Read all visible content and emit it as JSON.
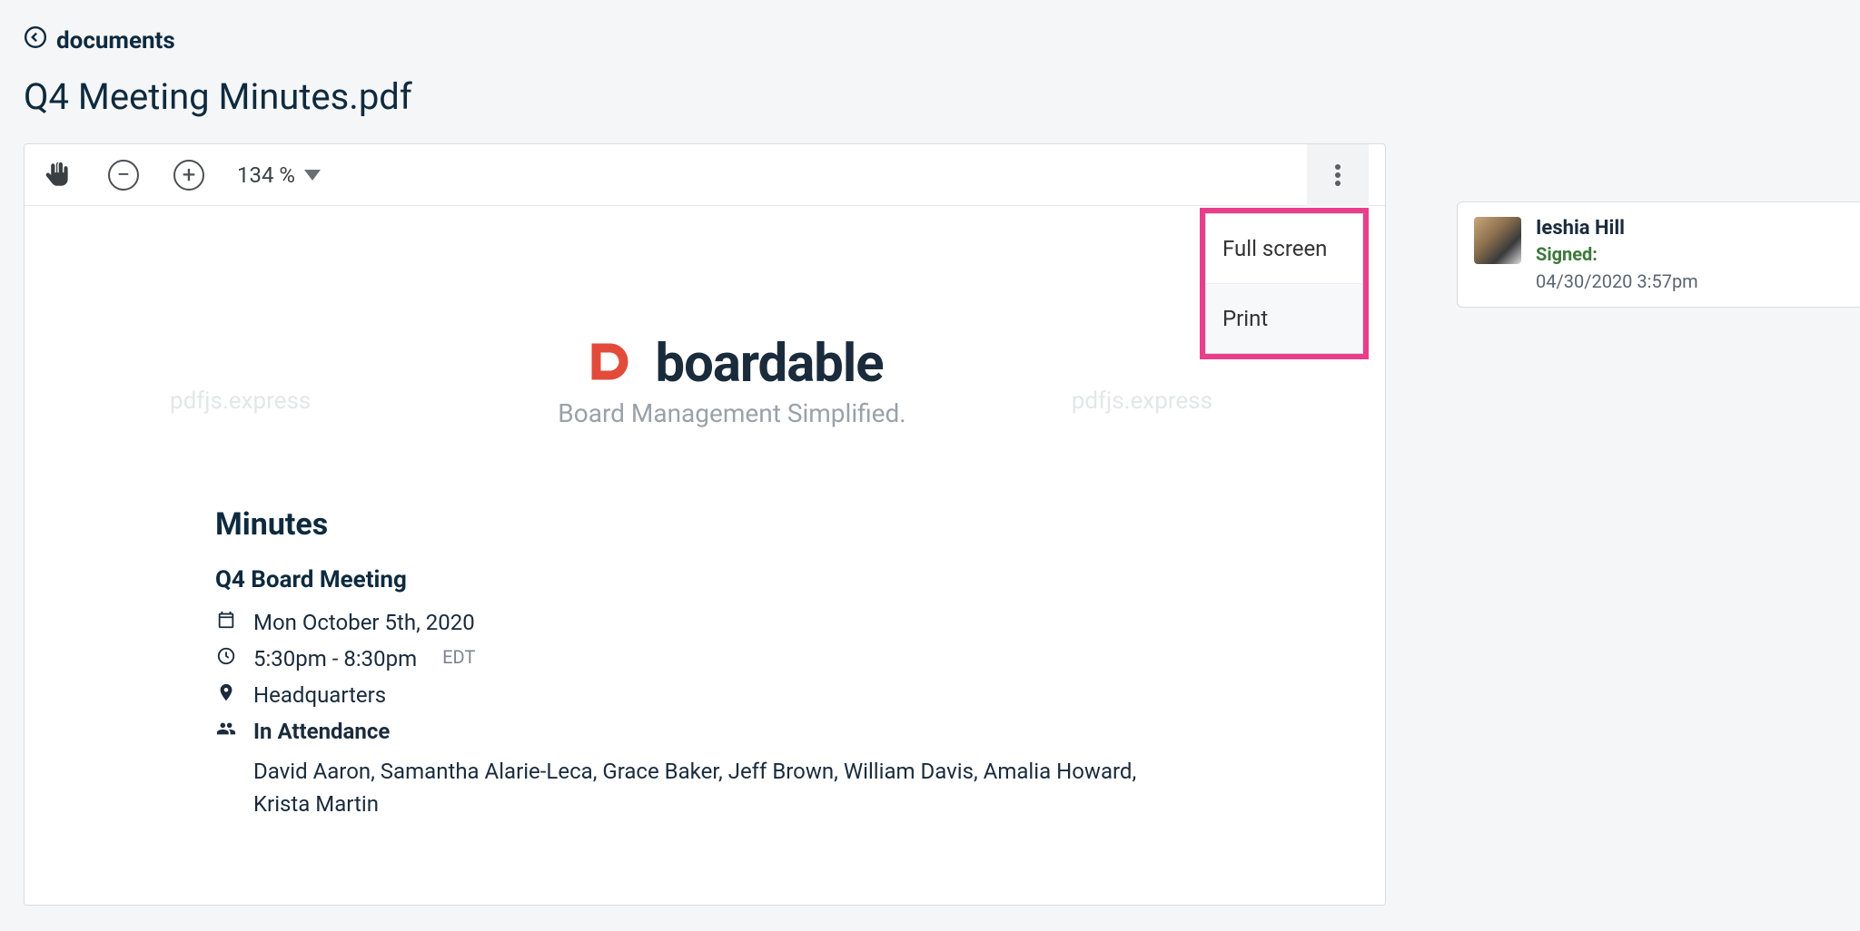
{
  "breadcrumb": {
    "label": "documents"
  },
  "page": {
    "title": "Q4 Meeting Minutes.pdf"
  },
  "toolbar": {
    "zoom_value": "134 %",
    "menu": {
      "fullscreen": "Full screen",
      "print": "Print"
    }
  },
  "watermark": "pdfjs.express",
  "logo": {
    "name": "boardable",
    "tagline": "Board Management Simplified."
  },
  "doc": {
    "minutes_heading": "Minutes",
    "meeting_title": "Q4 Board Meeting",
    "date": "Mon October 5th, 2020",
    "time": "5:30pm - 8:30pm",
    "timezone": "EDT",
    "location": "Headquarters",
    "attendance_label": "In Attendance",
    "attendees": "David Aaron, Samantha Alarie-Leca, Grace Baker, Jeff Brown, William Davis, Amalia Howard, Krista Martin"
  },
  "signer": {
    "name": "Ieshia Hill",
    "status": "Signed:",
    "timestamp": "04/30/2020 3:57pm"
  }
}
